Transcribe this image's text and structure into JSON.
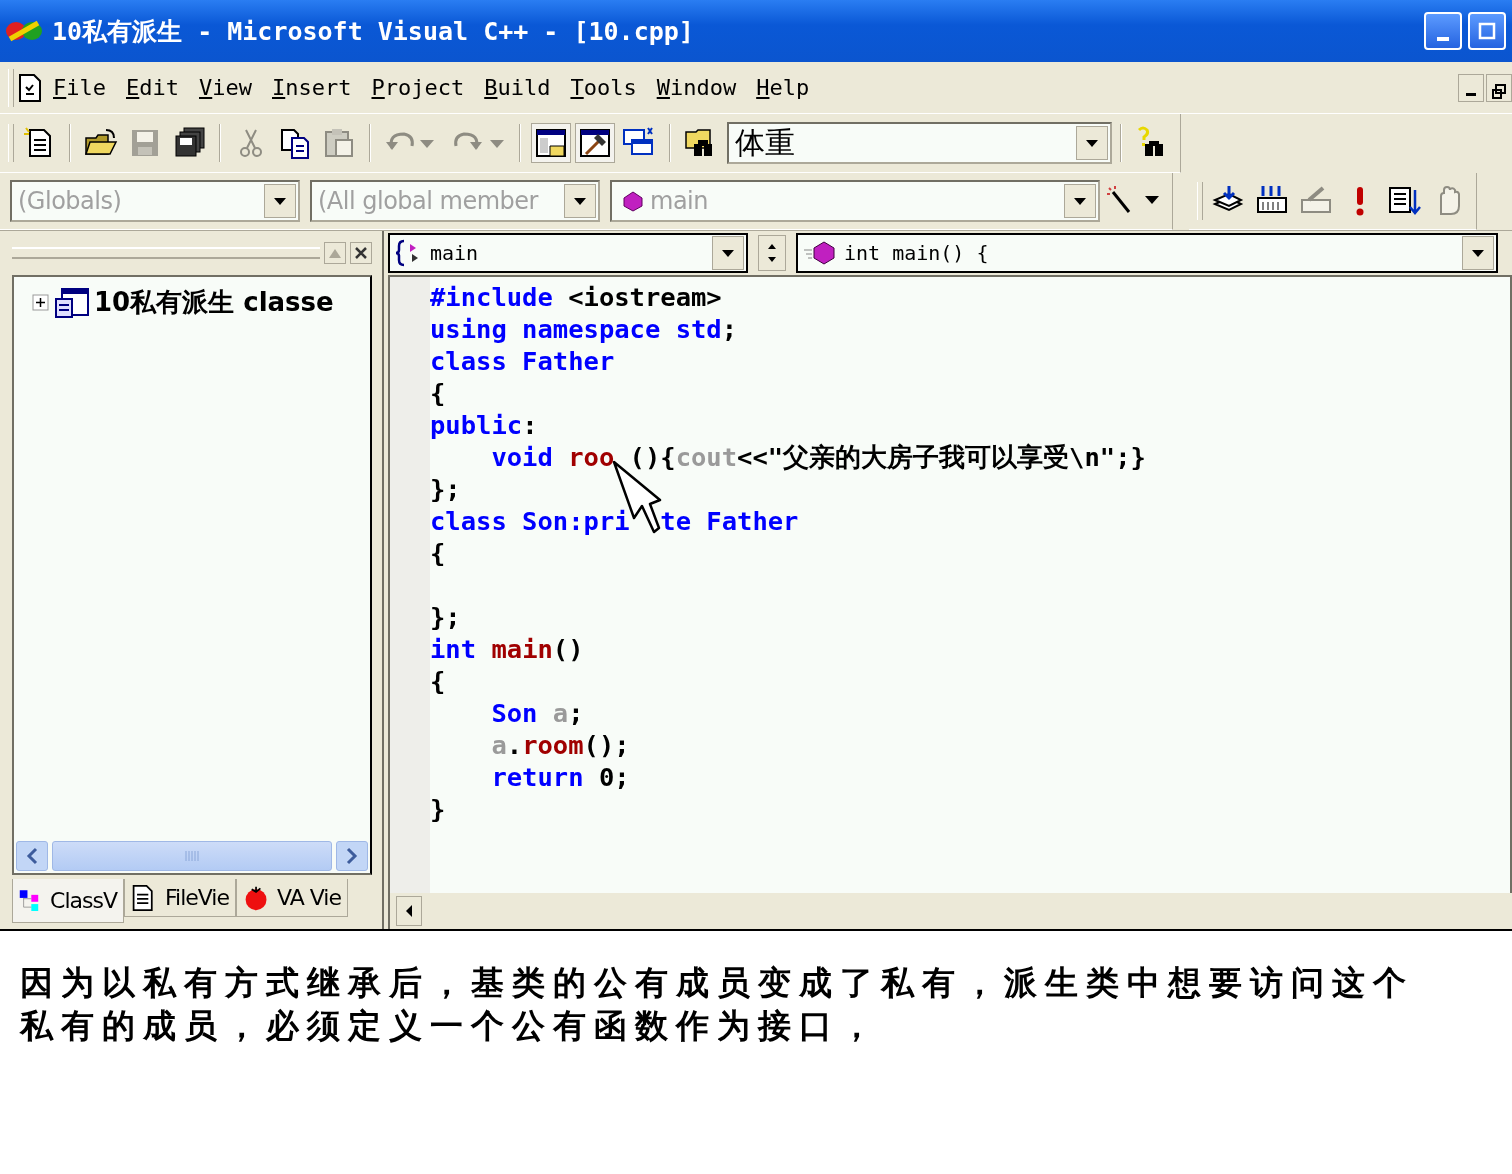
{
  "window": {
    "title": "10私有派生 - Microsoft Visual C++ - [10.cpp]"
  },
  "menu": [
    "File",
    "Edit",
    "View",
    "Insert",
    "Project",
    "Build",
    "Tools",
    "Window",
    "Help"
  ],
  "toolbar": {
    "buttons": [
      {
        "disabled": false,
        "checked": false
      },
      {
        "disabled": false,
        "checked": false
      },
      {
        "disabled": true,
        "checked": false
      },
      {
        "disabled": false,
        "checked": false
      },
      {
        "disabled": true,
        "checked": false
      },
      {
        "disabled": false,
        "checked": false
      },
      {
        "disabled": true,
        "checked": false
      },
      {
        "disabled": true,
        "checked": false
      },
      {
        "disabled": true,
        "checked": false
      },
      {
        "disabled": false,
        "checked": true
      },
      {
        "disabled": false,
        "checked": true
      },
      {
        "disabled": false,
        "checked": false
      },
      {
        "disabled": false,
        "checked": false
      }
    ],
    "find": {
      "value": "体重"
    }
  },
  "wizard_bar": {
    "combos": [
      {
        "value": "(Globals)",
        "disabled": true
      },
      {
        "value": "(All global member",
        "disabled": true
      },
      {
        "value": "main",
        "disabled": true
      }
    ]
  },
  "build_toolbar": {
    "buttons": [
      {
        "disabled": false
      },
      {
        "disabled": false
      },
      {
        "disabled": true
      },
      {
        "disabled": false
      },
      {
        "disabled": false
      },
      {
        "disabled": true
      }
    ]
  },
  "workspace": {
    "tree": [
      {
        "label": "10私有派生 classe",
        "expanded": false
      }
    ],
    "tabs": [
      {
        "label": "ClassV",
        "selected": true
      },
      {
        "label": "FileVie",
        "selected": false
      },
      {
        "label": "VA Vie",
        "selected": false
      }
    ]
  },
  "editor": {
    "symbol_combo": "main",
    "definition_combo": "int main() {",
    "lines": [
      {
        "segments": [
          {
            "kind": "keyword",
            "text": "#include"
          },
          {
            "kind": "plain",
            "text": " <iostream>"
          }
        ]
      },
      {
        "segments": [
          {
            "kind": "keyword",
            "text": "using namespace std"
          },
          {
            "kind": "plain",
            "text": ";"
          }
        ]
      },
      {
        "segments": [
          {
            "kind": "keyword",
            "text": "class Father"
          }
        ]
      },
      {
        "segments": [
          {
            "kind": "plain",
            "text": "{"
          }
        ]
      },
      {
        "segments": [
          {
            "kind": "keyword",
            "text": "public"
          },
          {
            "kind": "plain",
            "text": ":"
          }
        ]
      },
      {
        "segments": [
          {
            "kind": "keyword",
            "text": "    void "
          },
          {
            "kind": "function",
            "text": "roo"
          },
          {
            "kind": "gap"
          },
          {
            "kind": "plain",
            "text": "(){"
          },
          {
            "kind": "dim",
            "text": "cout"
          },
          {
            "kind": "plain",
            "text": "<<\"父亲的大房子我可以享受\\n\";}"
          }
        ]
      },
      {
        "segments": [
          {
            "kind": "plain",
            "text": "};"
          }
        ]
      },
      {
        "segments": [
          {
            "kind": "keyword",
            "text": "class Son:pri"
          },
          {
            "kind": "gap"
          },
          {
            "kind": "gap"
          },
          {
            "kind": "keyword",
            "text": "te Father"
          }
        ]
      },
      {
        "segments": [
          {
            "kind": "plain",
            "text": "{"
          }
        ]
      },
      {
        "kind": "blank"
      },
      {
        "segments": [
          {
            "kind": "plain",
            "text": "};"
          }
        ]
      },
      {
        "segments": [
          {
            "kind": "keyword",
            "text": "int "
          },
          {
            "kind": "function",
            "text": "main"
          },
          {
            "kind": "plain",
            "text": "()"
          }
        ]
      },
      {
        "segments": [
          {
            "kind": "plain",
            "text": "{"
          }
        ]
      },
      {
        "segments": [
          {
            "kind": "keyword",
            "text": "    Son "
          },
          {
            "kind": "dim",
            "text": "a"
          },
          {
            "kind": "plain",
            "text": ";"
          }
        ]
      },
      {
        "segments": [
          {
            "kind": "dim",
            "text": "    a"
          },
          {
            "kind": "plain",
            "text": "."
          },
          {
            "kind": "function",
            "text": "room"
          },
          {
            "kind": "plain",
            "text": "();"
          }
        ]
      },
      {
        "segments": [
          {
            "kind": "keyword",
            "text": "    return "
          },
          {
            "kind": "plain",
            "text": "0;"
          }
        ]
      },
      {
        "segments": [
          {
            "kind": "plain",
            "text": "}"
          }
        ]
      }
    ]
  },
  "caption": {
    "lines": [
      "因为以私有方式继承后，基类的公有成员变成了私有，派生类中想要访问这个",
      "私有的成员，必须定义一个公有函数作为接口，"
    ]
  }
}
